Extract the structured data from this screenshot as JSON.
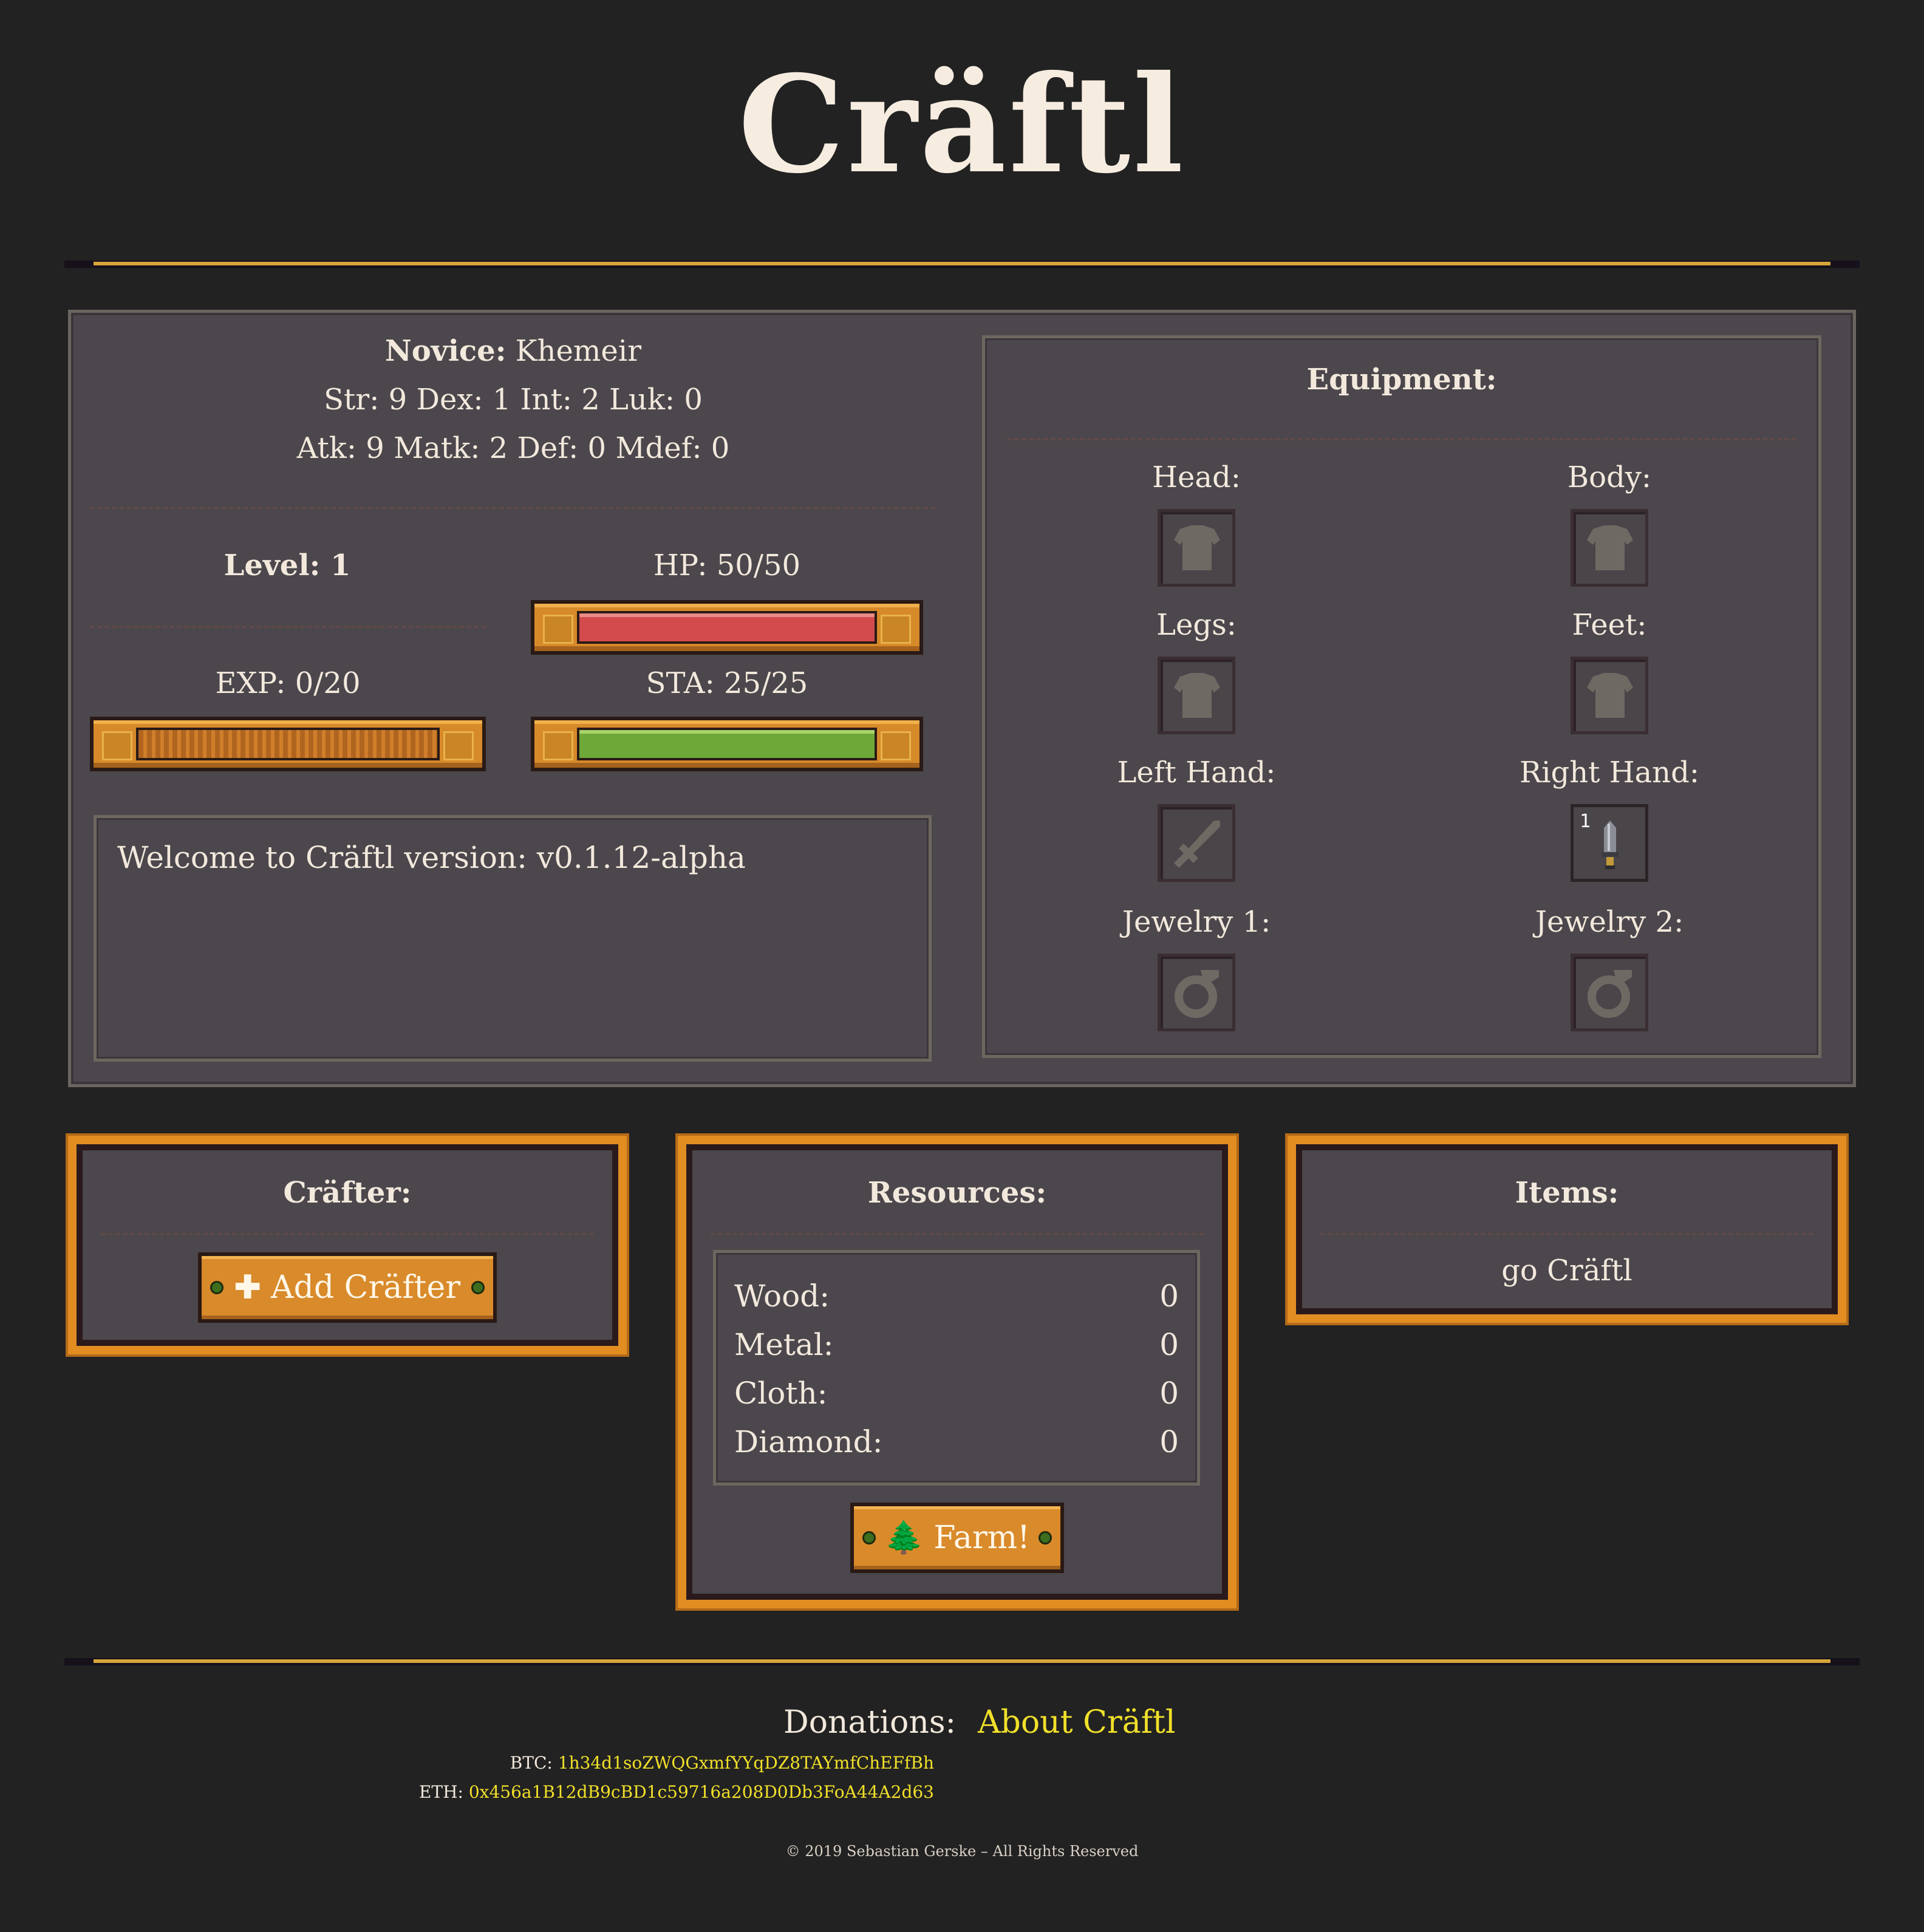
{
  "app": {
    "title": "Cräftl"
  },
  "character": {
    "class_label": "Novice:",
    "name": "Khemeir",
    "stats_line": "Str: 9 Dex: 1 Int: 2 Luk: 0",
    "combat_line": "Atk: 9 Matk: 2 Def: 0 Mdef: 0",
    "level_label": "Level: 1",
    "hp_label": "HP: 50/50",
    "exp_label": "EXP: 0/20",
    "sta_label": "STA: 25/25",
    "hp_fraction": 1.0,
    "exp_fraction": 0.0,
    "sta_fraction": 1.0
  },
  "log": {
    "message": "Welcome to Cräftl version: v0.1.12-alpha"
  },
  "equipment": {
    "title": "Equipment:",
    "slots": [
      {
        "label": "Head:",
        "icon": "armor-icon"
      },
      {
        "label": "Body:",
        "icon": "armor-icon"
      },
      {
        "label": "Legs:",
        "icon": "armor-icon"
      },
      {
        "label": "Feet:",
        "icon": "armor-icon"
      },
      {
        "label": "Left Hand:",
        "icon": "sword-icon"
      },
      {
        "label": "Right Hand:",
        "icon": "dagger-icon",
        "count": "1"
      },
      {
        "label": "Jewelry 1:",
        "icon": "ring-icon"
      },
      {
        "label": "Jewelry 2:",
        "icon": "ring-icon"
      }
    ]
  },
  "crafter": {
    "title": "Cräfter:",
    "add_button": "Add Cräfter"
  },
  "resources": {
    "title": "Resources:",
    "items": [
      {
        "name": "Wood:",
        "value": "0"
      },
      {
        "name": "Metal:",
        "value": "0"
      },
      {
        "name": "Cloth:",
        "value": "0"
      },
      {
        "name": "Diamond:",
        "value": "0"
      }
    ],
    "farm_button": "Farm!"
  },
  "items": {
    "title": "Items:",
    "message": "go Cräftl"
  },
  "footer": {
    "donations_label": "Donations:",
    "about_link": "About Cräftl",
    "btc_label": "BTC:",
    "btc_address": "1h34d1soZWQGxmfYYqDZ8TAYmfChEFfBh",
    "eth_label": "ETH:",
    "eth_address": "0x456a1B12dB9cBD1c59716a208D0Db3FoA44A2d63",
    "copyright": "© 2019 Sebastian Gerske – All Rights Reserved"
  },
  "colors": {
    "accent": "#d7a53a",
    "hp": "#d34b4c",
    "sta": "#6da838",
    "link": "#f1e02a",
    "background": "#222222"
  }
}
